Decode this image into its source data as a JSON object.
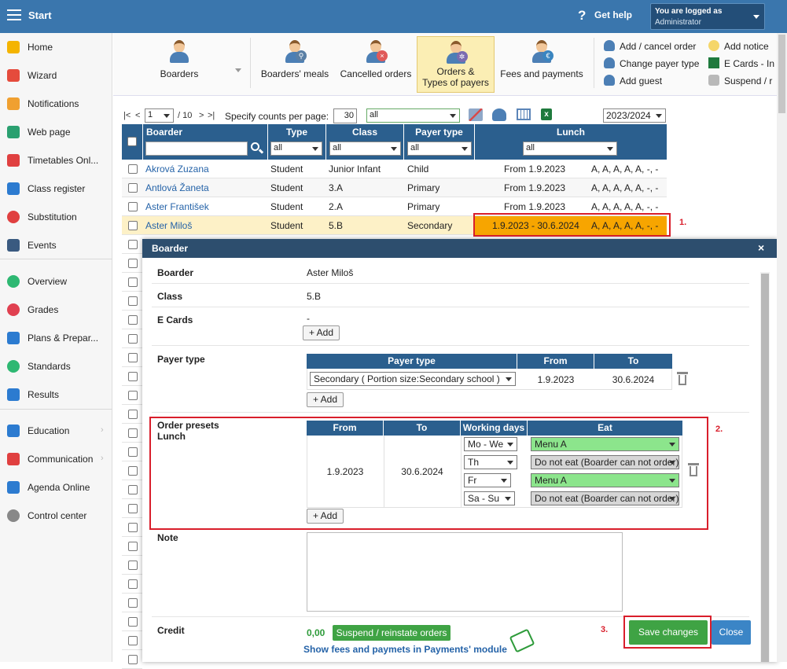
{
  "topbar": {
    "app_title": "Start",
    "help_icon": "?",
    "help_label": "Get help",
    "login_line1": "You are logged as",
    "login_line2": "Administrator"
  },
  "sidebar": {
    "items": [
      {
        "label": "Home",
        "icon": "star-icon",
        "color": "#f4b400"
      },
      {
        "label": "Wizard",
        "icon": "wand-icon",
        "color": "#e54b3c"
      },
      {
        "label": "Notifications",
        "icon": "envelope-icon",
        "color": "#f0a030"
      },
      {
        "label": "Web page",
        "icon": "house-icon",
        "color": "#2aa070"
      },
      {
        "label": "Timetables Onl...",
        "icon": "calendar-icon",
        "color": "#e04040"
      },
      {
        "label": "Class register",
        "icon": "book-icon",
        "color": "#2c7bd0"
      },
      {
        "label": "Substitution",
        "icon": "person-icon",
        "color": "#e04040"
      },
      {
        "label": "Events",
        "icon": "calendar-grid-icon",
        "color": "#3a5a80"
      },
      {
        "label": "Overview",
        "icon": "check-circle-icon",
        "color": "#2eb872"
      },
      {
        "label": "Grades",
        "icon": "grade-icon",
        "color": "#e04050"
      },
      {
        "label": "Plans & Prepar...",
        "icon": "plans-icon",
        "color": "#2c7bd0"
      },
      {
        "label": "Standards",
        "icon": "shield-check-icon",
        "color": "#2eb872"
      },
      {
        "label": "Results",
        "icon": "bar-chart-icon",
        "color": "#2c7bd0"
      },
      {
        "label": "Education",
        "icon": "book-open-icon",
        "color": "#2c7bd0"
      },
      {
        "label": "Communication",
        "icon": "chat-icon",
        "color": "#e04040"
      },
      {
        "label": "Agenda Online",
        "icon": "pen-icon",
        "color": "#2c7bd0"
      },
      {
        "label": "Control center",
        "icon": "gear-icon",
        "color": "#888888"
      }
    ]
  },
  "ribbon": {
    "boarders": "Boarders",
    "boarders_meals": "Boarders' meals",
    "cancelled_orders": "Cancelled orders",
    "orders_types_line1": "Orders &",
    "orders_types_line2": "Types of payers",
    "fees_payments": "Fees and payments",
    "add_cancel_order": "Add / cancel order",
    "change_payer_type": "Change payer type",
    "add_guest": "Add guest",
    "add_notice": "Add notice",
    "e_cards": "E Cards - In",
    "suspend": "Suspend / r"
  },
  "toolbar": {
    "first": "|<",
    "prev": "<",
    "page": "1",
    "of_pages": "/ 10",
    "next": ">",
    "last": ">|",
    "counts_label": "Specify counts per page:",
    "counts_value": "30",
    "filter_value": "all",
    "school_year": "2023/2024"
  },
  "table": {
    "headers": {
      "boarder": "Boarder",
      "type": "Type",
      "class": "Class",
      "payer_type": "Payer type",
      "lunch": "Lunch"
    },
    "filters": {
      "type": "all",
      "class": "all",
      "payer_type": "all",
      "lunch": "all"
    },
    "rows": [
      {
        "name": "Akrová Zuzana",
        "type": "Student",
        "class": "Junior Infant",
        "payer_type": "Child",
        "lunch_from": "From 1.9.2023",
        "lunch_days": "A, A, A, A, A, -, -"
      },
      {
        "name": "Antlová Žaneta",
        "type": "Student",
        "class": "3.A",
        "payer_type": "Primary",
        "lunch_from": "From 1.9.2023",
        "lunch_days": "A, A, A, A, A, -, -"
      },
      {
        "name": "Aster František",
        "type": "Student",
        "class": "2.A",
        "payer_type": "Primary",
        "lunch_from": "From 1.9.2023",
        "lunch_days": "A, A, A, A, A, -, -"
      },
      {
        "name": "Aster Miloš",
        "type": "Student",
        "class": "5.B",
        "payer_type": "Secondary",
        "lunch_from": "1.9.2023 - 30.6.2024",
        "lunch_days": "A, A, A, A, A, -, -"
      }
    ]
  },
  "annotations": {
    "one": "1.",
    "two": "2.",
    "three": "3."
  },
  "modal": {
    "title": "Boarder",
    "close": "×",
    "boarder_label": "Boarder",
    "boarder_value": "Aster Miloš",
    "class_label": "Class",
    "class_value": "5.B",
    "ecards_label": "E Cards",
    "ecards_value": "-",
    "add_label": "+ Add",
    "payer_label": "Payer type",
    "payer_table": {
      "headers": {
        "payer_type": "Payer type",
        "from": "From",
        "to": "To"
      },
      "row": {
        "payer_type": "Secondary ( Portion size:Secondary school )",
        "from": "1.9.2023",
        "to": "30.6.2024"
      }
    },
    "presets_label_1": "Order presets",
    "presets_label_2": "Lunch",
    "presets_table": {
      "headers": {
        "from": "From",
        "to": "To",
        "working_days": "Working days",
        "eat": "Eat"
      },
      "from": "1.9.2023",
      "to": "30.6.2024",
      "rows": [
        {
          "days": "Mo - We",
          "eat": "Menu A",
          "eat_state": "green"
        },
        {
          "days": "Th",
          "eat": "Do not eat (Boarder can not order)",
          "eat_state": "gray"
        },
        {
          "days": "Fr",
          "eat": "Menu A",
          "eat_state": "green"
        },
        {
          "days": "Sa - Su",
          "eat": "Do not eat (Boarder can not order)",
          "eat_state": "gray"
        }
      ]
    },
    "note_label": "Note",
    "credit_label": "Credit",
    "credit_value": "0,00",
    "suspend_button": "Suspend / reinstate orders",
    "fees_link": "Show fees and paymets in Payments' module",
    "save_button": "Save changes",
    "close_button": "Close"
  },
  "colors": {
    "topbar": "#3a76ad",
    "header": "#2b5f8e",
    "highlight_row": "#fdf1c7",
    "lunch_highlight": "#f7a500",
    "annotation_red": "#d91e2b",
    "save_green": "#3fa344",
    "close_blue": "#3b85c6"
  }
}
